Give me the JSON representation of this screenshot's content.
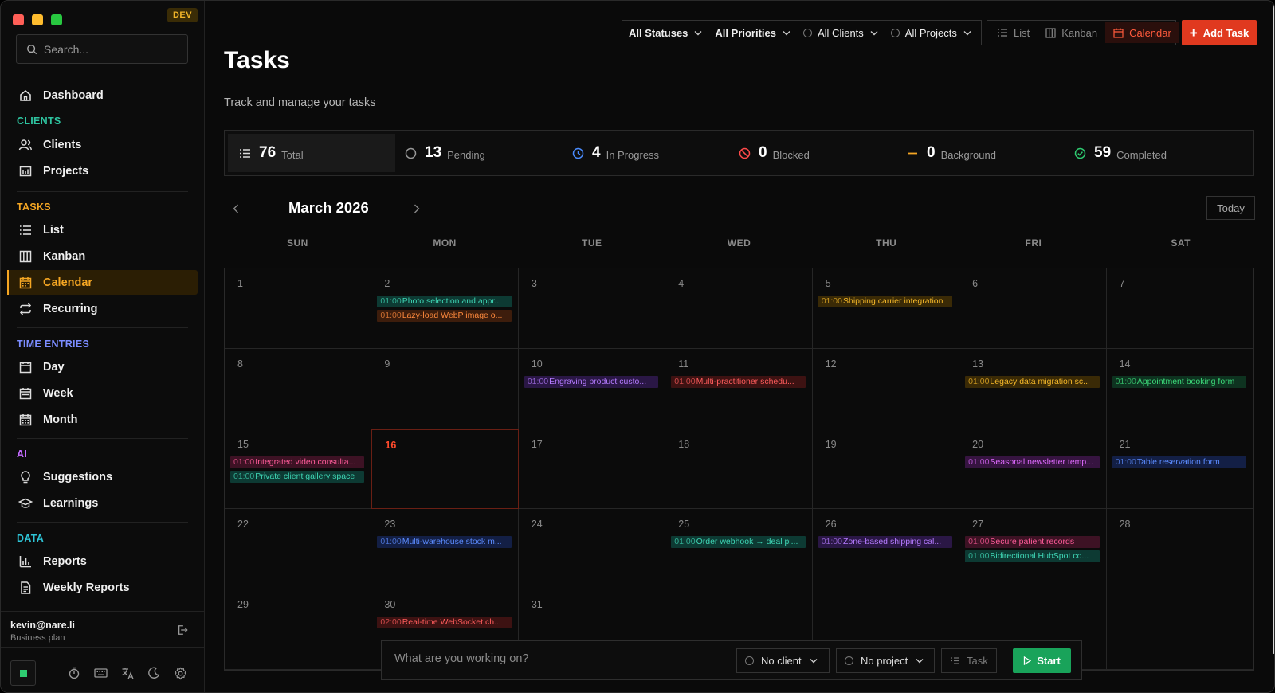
{
  "window": {
    "dev_badge": "DEV"
  },
  "sidebar": {
    "search_placeholder": "Search...",
    "dashboard": "Dashboard",
    "sections": {
      "clients": "CLIENTS",
      "tasks": "TASKS",
      "time_entries": "TIME ENTRIES",
      "ai": "AI",
      "data": "DATA"
    },
    "items": {
      "clients": "Clients",
      "projects": "Projects",
      "list": "List",
      "kanban": "Kanban",
      "calendar": "Calendar",
      "recurring": "Recurring",
      "day": "Day",
      "week": "Week",
      "month": "Month",
      "suggestions": "Suggestions",
      "learnings": "Learnings",
      "reports": "Reports",
      "weekly_reports": "Weekly Reports"
    },
    "user": {
      "email": "kevin@nare.li",
      "plan": "Business plan"
    },
    "colors": {
      "clients": "#2ec4a0",
      "tasks": "#f5a623",
      "time_entries": "#7b8cff",
      "ai": "#c46bff",
      "data": "#2ec4d6"
    }
  },
  "toolbar": {
    "status_filter": "All Statuses",
    "priority_filter": "All Priorities",
    "client_filter": "All Clients",
    "project_filter": "All Projects",
    "view_list": "List",
    "view_kanban": "Kanban",
    "view_calendar": "Calendar",
    "add_task": "Add Task"
  },
  "page": {
    "title": "Tasks",
    "subtitle": "Track and manage your tasks"
  },
  "stats": {
    "total": {
      "value": "76",
      "label": "Total"
    },
    "pending": {
      "value": "13",
      "label": "Pending"
    },
    "in_progress": {
      "value": "4",
      "label": "In Progress"
    },
    "blocked": {
      "value": "0",
      "label": "Blocked"
    },
    "background": {
      "value": "0",
      "label": "Background"
    },
    "completed": {
      "value": "59",
      "label": "Completed"
    }
  },
  "calendar": {
    "month_title": "March 2026",
    "today_label": "Today",
    "today_day": 16,
    "weekdays": [
      "SUN",
      "MON",
      "TUE",
      "WED",
      "THU",
      "FRI",
      "SAT"
    ],
    "weeks": [
      [
        {
          "day": "1",
          "events": []
        },
        {
          "day": "2",
          "events": [
            {
              "time": "01:00",
              "title": "Photo selection and appr...",
              "color": "teal"
            },
            {
              "time": "01:00",
              "title": "Lazy-load WebP image o...",
              "color": "orange"
            }
          ]
        },
        {
          "day": "3",
          "events": []
        },
        {
          "day": "4",
          "events": []
        },
        {
          "day": "5",
          "events": [
            {
              "time": "01:00",
              "title": "Shipping carrier integration",
              "color": "amber"
            }
          ]
        },
        {
          "day": "6",
          "events": []
        },
        {
          "day": "7",
          "events": []
        }
      ],
      [
        {
          "day": "8",
          "events": []
        },
        {
          "day": "9",
          "events": []
        },
        {
          "day": "10",
          "events": [
            {
              "time": "01:00",
              "title": "Engraving product custo...",
              "color": "purple"
            }
          ]
        },
        {
          "day": "11",
          "events": [
            {
              "time": "01:00",
              "title": "Multi-practitioner schedu...",
              "color": "red"
            }
          ]
        },
        {
          "day": "12",
          "events": []
        },
        {
          "day": "13",
          "events": [
            {
              "time": "01:00",
              "title": "Legacy data migration sc...",
              "color": "amber"
            }
          ]
        },
        {
          "day": "14",
          "events": [
            {
              "time": "01:00",
              "title": "Appointment booking form",
              "color": "green"
            }
          ]
        }
      ],
      [
        {
          "day": "15",
          "events": [
            {
              "time": "01:00",
              "title": "Integrated video consulta...",
              "color": "pink"
            },
            {
              "time": "01:00",
              "title": "Private client gallery space",
              "color": "teal"
            }
          ]
        },
        {
          "day": "16",
          "events": []
        },
        {
          "day": "17",
          "events": []
        },
        {
          "day": "18",
          "events": []
        },
        {
          "day": "19",
          "events": []
        },
        {
          "day": "20",
          "events": [
            {
              "time": "01:00",
              "title": "Seasonal newsletter temp...",
              "color": "magenta"
            }
          ]
        },
        {
          "day": "21",
          "events": [
            {
              "time": "01:00",
              "title": "Table reservation form",
              "color": "blue"
            }
          ]
        }
      ],
      [
        {
          "day": "22",
          "events": []
        },
        {
          "day": "23",
          "events": [
            {
              "time": "01:00",
              "title": "Multi-warehouse stock m...",
              "color": "blue"
            }
          ]
        },
        {
          "day": "24",
          "events": []
        },
        {
          "day": "25",
          "events": [
            {
              "time": "01:00",
              "title": "Order webhook → deal pi...",
              "color": "teal"
            }
          ]
        },
        {
          "day": "26",
          "events": [
            {
              "time": "01:00",
              "title": "Zone-based shipping cal...",
              "color": "purple"
            }
          ]
        },
        {
          "day": "27",
          "events": [
            {
              "time": "01:00",
              "title": "Secure patient records",
              "color": "pink"
            },
            {
              "time": "01:00",
              "title": "Bidirectional HubSpot co...",
              "color": "teal"
            }
          ]
        },
        {
          "day": "28",
          "events": []
        }
      ],
      [
        {
          "day": "29",
          "events": []
        },
        {
          "day": "30",
          "events": [
            {
              "time": "02:00",
              "title": "Real-time WebSocket ch...",
              "color": "red"
            }
          ]
        },
        {
          "day": "31",
          "events": []
        },
        {
          "day": "",
          "events": []
        },
        {
          "day": "",
          "events": []
        },
        {
          "day": "",
          "events": []
        },
        {
          "day": "",
          "events": []
        }
      ]
    ],
    "event_colors": {
      "teal": {
        "bg": "#0d3a33",
        "fg": "#3fd6b5"
      },
      "orange": {
        "bg": "#3d1d0c",
        "fg": "#ff8a3d"
      },
      "amber": {
        "bg": "#3a2a06",
        "fg": "#f5b829"
      },
      "purple": {
        "bg": "#2a1745",
        "fg": "#b57bff"
      },
      "red": {
        "bg": "#3d1212",
        "fg": "#ff5c5c"
      },
      "green": {
        "bg": "#0e3320",
        "fg": "#3ddc7a"
      },
      "pink": {
        "bg": "#3d1224",
        "fg": "#ff5c9a"
      },
      "magenta": {
        "bg": "#361440",
        "fg": "#e06bff"
      },
      "blue": {
        "bg": "#131f45",
        "fg": "#5c8cff"
      }
    }
  },
  "tracker": {
    "placeholder": "What are you working on?",
    "client": "No client",
    "project": "No project",
    "task": "Task",
    "start": "Start"
  }
}
